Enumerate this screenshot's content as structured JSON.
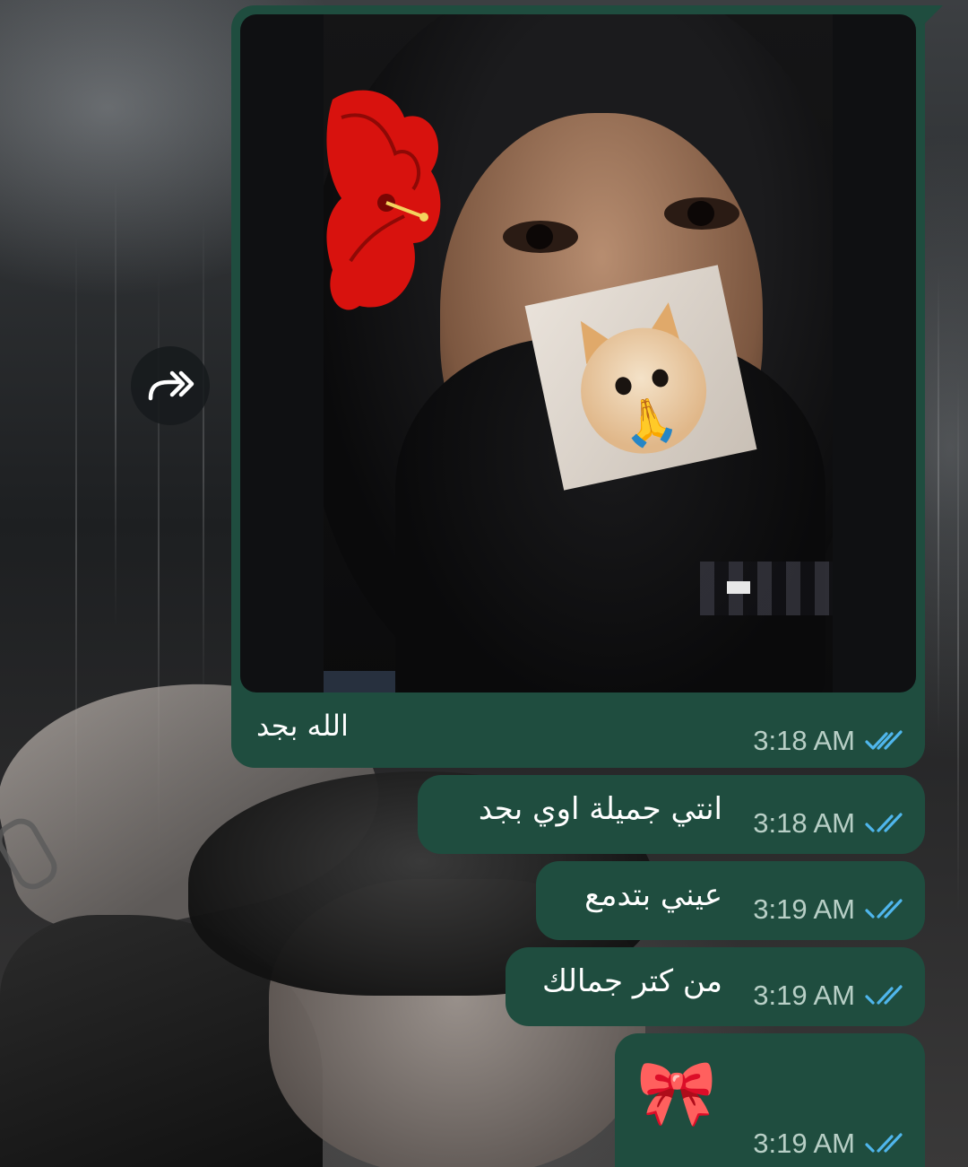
{
  "messages": [
    {
      "type": "image",
      "caption": "الله بجد",
      "time": "3:18 AM",
      "status": "read"
    },
    {
      "type": "text",
      "text": "انتي جميلة اوي بجد",
      "time": "3:18 AM",
      "status": "read"
    },
    {
      "type": "text",
      "text": "عيني بتدمع",
      "time": "3:19 AM",
      "status": "read"
    },
    {
      "type": "text",
      "text": "من كتر جمالك",
      "time": "3:19 AM",
      "status": "read"
    },
    {
      "type": "emoji",
      "text": "🎀",
      "time": "3:19 AM",
      "status": "read"
    }
  ],
  "icons": {
    "forward": "forward-icon",
    "read_receipt": "double-check-icon",
    "image_stickers": [
      "hibiscus-flower-sticker",
      "praying-cat-sticker",
      "folded-hands-emoji"
    ]
  },
  "colors": {
    "bubble": "#1f4d3f",
    "time_text": "#b8cfc6",
    "read_ticks": "#4fb6ec",
    "forward_button": "#161a1c"
  }
}
